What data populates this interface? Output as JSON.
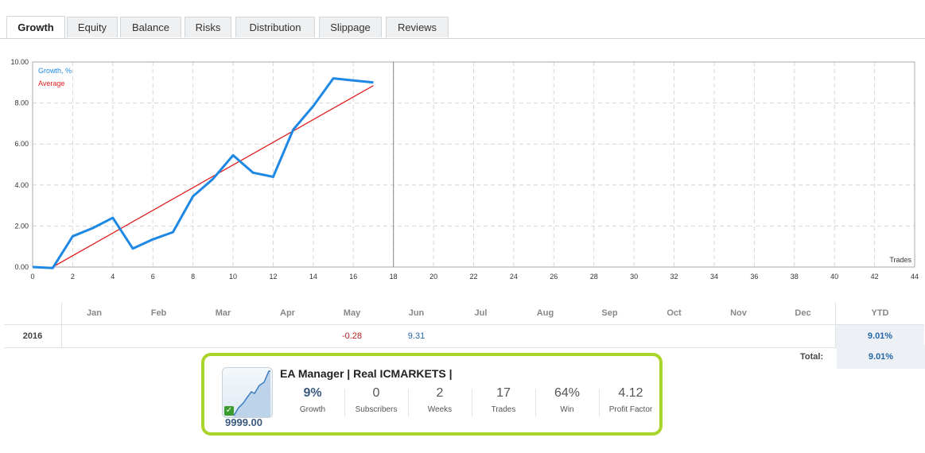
{
  "tabs": [
    "Growth",
    "Equity",
    "Balance",
    "Risks",
    "Distribution",
    "Slippage",
    "Reviews"
  ],
  "active_tab": "Growth",
  "chart_data": {
    "type": "line",
    "legend": [
      "Growth, %",
      "Average"
    ],
    "xlabel": "Trades",
    "xlim": [
      0,
      44
    ],
    "ylim": [
      0,
      10
    ],
    "x_ticks": [
      "0",
      "2",
      "4",
      "6",
      "8",
      "10",
      "12",
      "14",
      "16",
      "18",
      "20",
      "22",
      "24",
      "26",
      "28",
      "30",
      "32",
      "34",
      "36",
      "38",
      "40",
      "42",
      "44"
    ],
    "y_ticks": [
      "0.00",
      "2.00",
      "4.00",
      "6.00",
      "8.00",
      "10.00"
    ],
    "series": [
      {
        "name": "Growth, %",
        "color": "#1e88e5",
        "x": [
          0,
          1,
          2,
          3,
          4,
          5,
          6,
          7,
          8,
          9,
          10,
          11,
          12,
          13,
          14,
          15,
          16,
          17
        ],
        "y": [
          0,
          -0.2,
          1.5,
          1.9,
          2.4,
          0.9,
          1.35,
          1.7,
          3.45,
          4.3,
          5.45,
          4.6,
          4.4,
          6.7,
          7.85,
          9.2,
          9.1,
          9.0
        ]
      },
      {
        "name": "Average",
        "color": "#e02020",
        "x": [
          1,
          17
        ],
        "y": [
          0,
          8.85
        ]
      }
    ],
    "divider_x": 18
  },
  "monthly": {
    "months": [
      "Jan",
      "Feb",
      "Mar",
      "Apr",
      "May",
      "Jun",
      "Jul",
      "Aug",
      "Sep",
      "Oct",
      "Nov",
      "Dec"
    ],
    "ytd_header": "YTD",
    "year": "2016",
    "values": [
      "",
      "",
      "",
      "",
      "-0.28",
      "9.31",
      "",
      "",
      "",
      "",
      "",
      ""
    ],
    "ytd": "9.01%",
    "total_label": "Total:",
    "total": "9.01%"
  },
  "card": {
    "title": "EA Manager | Real ICMARKETS |",
    "balance": "9999.00",
    "check_icon": "✓",
    "accent": "#a9d52a",
    "stats": [
      {
        "value": "9%",
        "label": "Growth"
      },
      {
        "value": "0",
        "label": "Subscribers"
      },
      {
        "value": "2",
        "label": "Weeks"
      },
      {
        "value": "17",
        "label": "Trades"
      },
      {
        "value": "64%",
        "label": "Win"
      },
      {
        "value": "4.12",
        "label": "Profit Factor"
      }
    ]
  }
}
